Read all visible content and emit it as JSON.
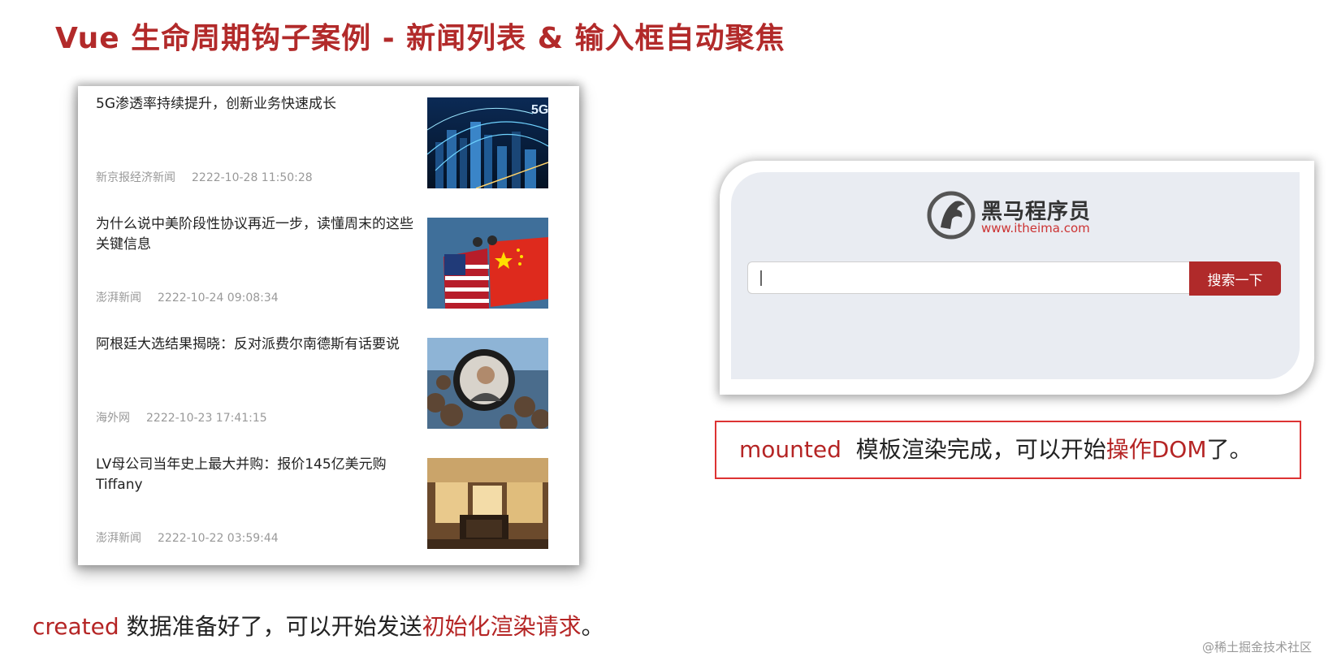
{
  "slide": {
    "title": "Vue 生命周期钩子案例 - 新闻列表 & 输入框自动聚焦"
  },
  "news": [
    {
      "title": "5G渗透率持续提升，创新业务快速成长",
      "source": "新京报经济新闻",
      "time": "2222-10-28 11:50:28"
    },
    {
      "title": "为什么说中美阶段性协议再近一步，读懂周末的这些关键信息",
      "source": "澎湃新闻",
      "time": "2222-10-24 09:08:34"
    },
    {
      "title": "阿根廷大选结果揭晓：反对派费尔南德斯有话要说",
      "source": "海外网",
      "time": "2222-10-23 17:41:15"
    },
    {
      "title": "LV母公司当年史上最大并购：报价145亿美元购Tiffany",
      "source": "澎湃新闻",
      "time": "2222-10-22 03:59:44"
    }
  ],
  "search": {
    "logo_name": "黑马程序员",
    "logo_url": "www.itheima.com",
    "input_value": "",
    "button_label": "搜索一下"
  },
  "notes": {
    "mounted_keyword": "mounted",
    "mounted_text": "模板渲染完成，可以开始",
    "mounted_highlight": "操作DOM",
    "mounted_end": "了。",
    "created_keyword": "created",
    "created_text": "数据准备好了，可以开始发送",
    "created_highlight": "初始化渲染请求",
    "created_end": "。"
  },
  "watermark": "@稀土掘金技术社区",
  "colors": {
    "accent_red": "#b22a2a",
    "panel_bg": "#e9ecf2",
    "button_red": "#b02a2a"
  }
}
